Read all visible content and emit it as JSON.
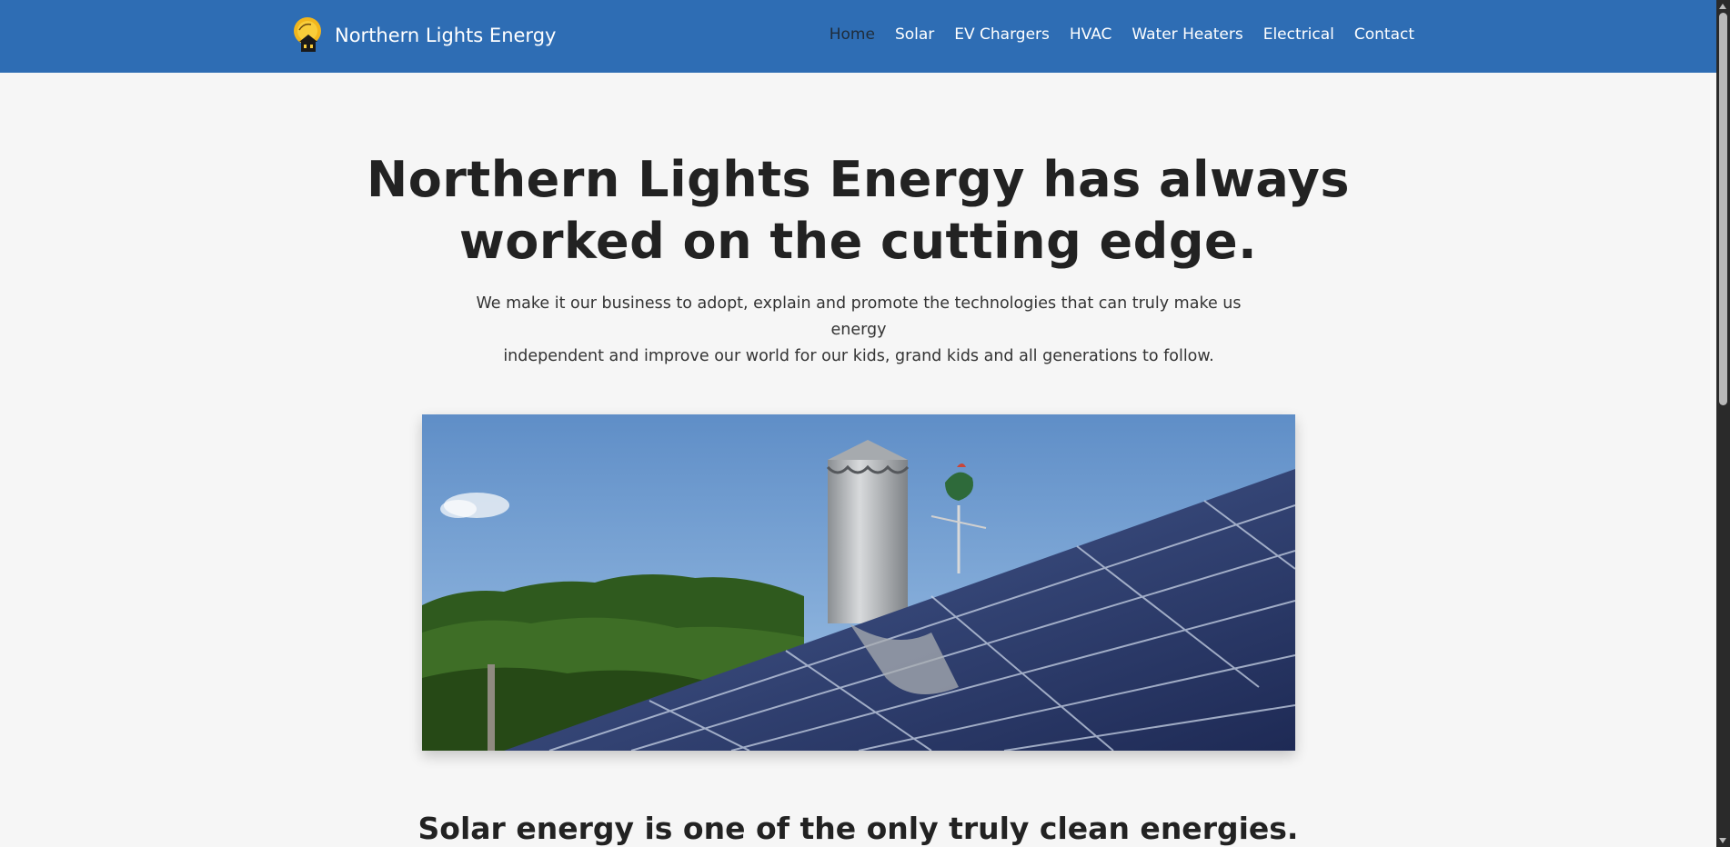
{
  "header": {
    "brand": "Northern Lights Energy",
    "logo_icon": "sun-house-logo-icon",
    "nav": [
      {
        "label": "Home",
        "active": true
      },
      {
        "label": "Solar",
        "active": false
      },
      {
        "label": "EV Chargers",
        "active": false
      },
      {
        "label": "HVAC",
        "active": false
      },
      {
        "label": "Water Heaters",
        "active": false
      },
      {
        "label": "Electrical",
        "active": false
      },
      {
        "label": "Contact",
        "active": false
      }
    ]
  },
  "hero": {
    "title_line1": "Northern Lights Energy has always",
    "title_line2": "worked on the cutting edge.",
    "subtitle_line1": "We make it our business to adopt, explain and promote the technologies that can truly make us energy",
    "subtitle_line2": "independent and improve our world for our kids, grand kids and all generations to follow."
  },
  "section": {
    "title": "Solar energy is one of the only truly clean energies."
  },
  "colors": {
    "header_bg": "#2e6db4",
    "page_bg": "#f6f6f6",
    "nav_active": "#1f2c3a"
  }
}
